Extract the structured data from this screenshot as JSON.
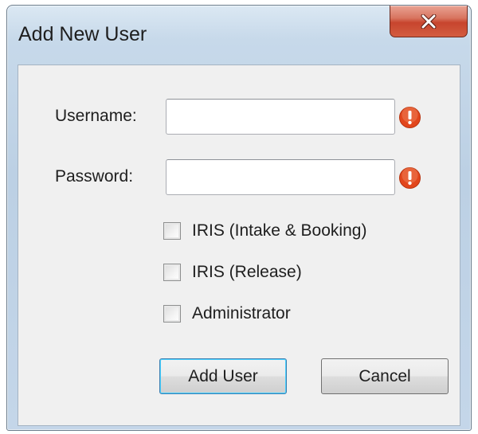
{
  "window": {
    "title": "Add New User",
    "close_icon": "close-icon"
  },
  "form": {
    "username": {
      "label": "Username:",
      "value": "",
      "error_icon": "error-icon"
    },
    "password": {
      "label": "Password:",
      "value": "",
      "error_icon": "error-icon"
    }
  },
  "options": [
    {
      "label": "IRIS (Intake & Booking)",
      "checked": false
    },
    {
      "label": "IRIS (Release)",
      "checked": false
    },
    {
      "label": "Administrator",
      "checked": false
    }
  ],
  "buttons": {
    "add_user": "Add User",
    "cancel": "Cancel"
  },
  "colors": {
    "error": "#e2461c",
    "close_button": "#c7452e",
    "default_button_border": "#3c7fb1"
  }
}
